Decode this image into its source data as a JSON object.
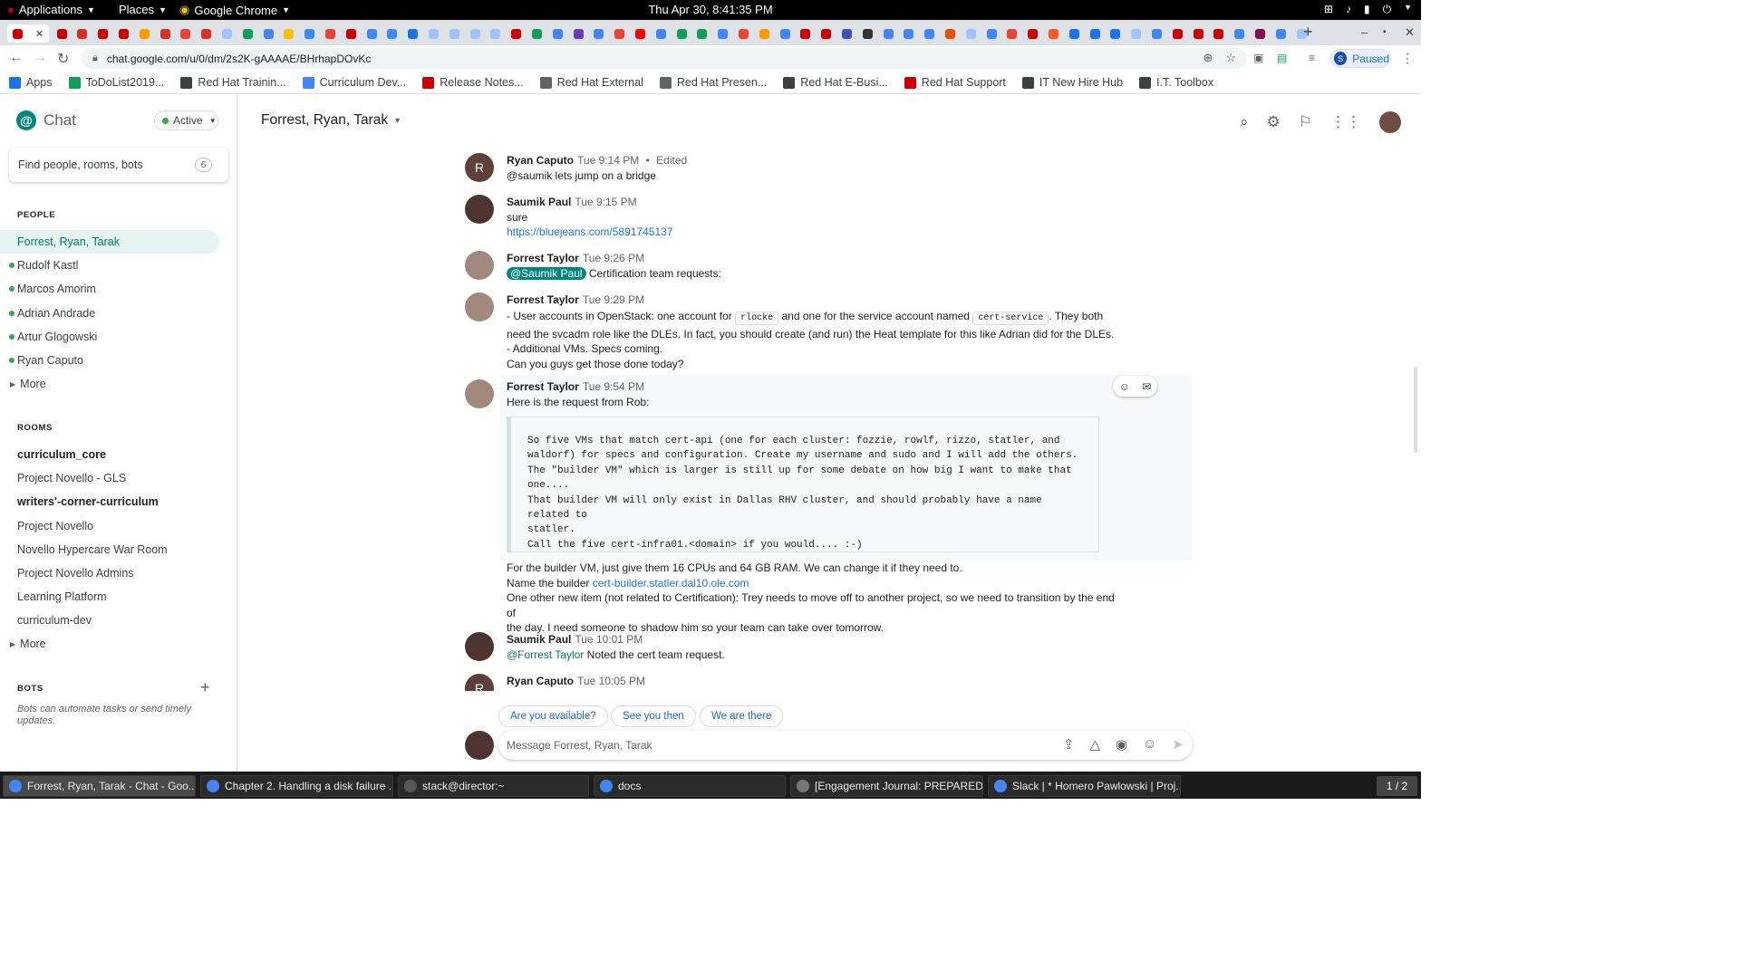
{
  "topbar": {
    "applications": "Applications",
    "places": "Places",
    "browser": "Google Chrome",
    "clock": "Thu Apr 30,  8:41:35 PM"
  },
  "browser": {
    "url": "chat.google.com/u/0/dm/2s2K-gAAAAE/BHrhapDOvKc",
    "profile_initial": "S",
    "profile_status": "Paused",
    "bookmarks": [
      {
        "label": "Apps",
        "color": "#1a73e8"
      },
      {
        "label": "ToDoList2019...",
        "color": "#0f9d58"
      },
      {
        "label": "Red Hat Trainin...",
        "color": "#3c4043"
      },
      {
        "label": "Curriculum Dev...",
        "color": "#4285f4"
      },
      {
        "label": "Release Notes...",
        "color": "#cc0000"
      },
      {
        "label": "Red Hat External",
        "color": "#5f6368"
      },
      {
        "label": "Red Hat Presen...",
        "color": "#5f6368"
      },
      {
        "label": "Red Hat E-Busi...",
        "color": "#3c4043"
      },
      {
        "label": "Red Hat Support",
        "color": "#cc0000"
      },
      {
        "label": "IT New Hire Hub",
        "color": "#3c4043"
      },
      {
        "label": "I.T. Toolbox",
        "color": "#3c4043"
      }
    ]
  },
  "chat": {
    "app_name": "Chat",
    "status": "Active",
    "search_placeholder": "Find people, rooms, bots",
    "search_shortcut": "6",
    "people_label": "PEOPLE",
    "people": [
      {
        "name": "Forrest, Ryan, Tarak",
        "selected": true,
        "online": false
      },
      {
        "name": "Rudolf Kastl",
        "online": true
      },
      {
        "name": "Marcos Amorim",
        "online": true
      },
      {
        "name": "Adrian Andrade",
        "online": true
      },
      {
        "name": "Artur Glogowski",
        "online": true
      },
      {
        "name": "Ryan Caputo",
        "online": true
      }
    ],
    "more_label": "More",
    "rooms_label": "ROOMS",
    "rooms": [
      {
        "name": "curriculum_core",
        "bold": true
      },
      {
        "name": "Project Novello - GLS",
        "bold": false
      },
      {
        "name": "writers'-corner-curriculum",
        "bold": true
      },
      {
        "name": "Project Novello",
        "bold": false
      },
      {
        "name": "Novello Hypercare War Room",
        "bold": false
      },
      {
        "name": "Project Novello Admins",
        "bold": false
      },
      {
        "name": "Learning Platform",
        "bold": false
      },
      {
        "name": "curriculum-dev",
        "bold": false
      }
    ],
    "bots_label": "BOTS",
    "bots_desc": "Bots can automate tasks or send timely updates.",
    "conversation_title": "Forrest, Ryan, Tarak",
    "messages": [
      {
        "author": "Ryan Caputo",
        "time": "Tue 9:14 PM",
        "edited": "Edited",
        "text": "@saumik lets jump on a bridge",
        "initial": "R"
      },
      {
        "author": "Saumik Paul",
        "time": "Tue 9:15 PM",
        "text": "sure",
        "link": "https://bluejeans.com/5891745137"
      },
      {
        "author": "Forrest Taylor",
        "time": "Tue 9:26 PM",
        "mention": "@Saumik Paul",
        "text": "Certification team requests:"
      },
      {
        "author": "Forrest Taylor",
        "time": "Tue 9:29 PM",
        "line1a": "- User accounts in OpenStack: one account for",
        "code1": "rlocke",
        "line1b": "and one for the service account named",
        "code2": "cert-service",
        "line1c": ".  They both",
        "line2": "need the svcadm role like the DLEs. In fact, you should create (and run) the Heat template for this like Adrian did for the DLEs.",
        "line3": "- Additional VMs.  Specs coming.",
        "line4": "Can you guys get those done today?"
      },
      {
        "author": "Forrest Taylor",
        "time": "Tue 9:54 PM",
        "intro": "Here is the request from Rob:",
        "codeblock": "So five VMs that match cert-api (one for each cluster: fozzie, rowlf, rizzo, statler, and\nwaldorf) for specs and configuration. Create my username and sudo and I will add the others.\nThe \"builder VM\" which is larger is still up for some debate on how big I want to make that\none....\nThat builder VM will only exist in Dallas RHV cluster, and should probably have a name related to\nstatler.\nCall the five cert-infra01.<domain> if you would.... :-)",
        "after1": "For the builder VM, just give them 16 CPUs and 64 GB RAM.  We can change it if they need to.",
        "after2_prefix": "Name the builder",
        "after2_link": "cert-builder.statler.dal10.ole.com",
        "after3": "One other new item (not related to Certification): Trey needs to move off to another project, so we need to transition by the end of",
        "after4": "the day.  I need someone to shadow him so your team can take over tomorrow."
      },
      {
        "author": "Saumik Paul",
        "time": "Tue 10:01 PM",
        "mention": "@Forrest Taylor",
        "text": "Noted the cert team request."
      },
      {
        "author": "Ryan Caputo",
        "time": "Tue 10:05 PM",
        "initial": "R"
      }
    ],
    "suggestions": [
      "Are you available?",
      "See you then",
      "We are there"
    ],
    "composer_placeholder": "Message Forrest, Ryan, Tarak"
  },
  "taskbar": {
    "tasks": [
      {
        "label": "Forrest, Ryan, Tarak - Chat - Goo...",
        "active": true,
        "color": "#4285f4"
      },
      {
        "label": "Chapter 2. Handling a disk failure ...",
        "active": false,
        "color": "#4285f4"
      },
      {
        "label": "stack@director:~",
        "active": false,
        "color": "#555555"
      },
      {
        "label": "docs",
        "active": false,
        "color": "#4285f4"
      },
      {
        "label": "[Engagement Journal: PREPARED ...",
        "active": false,
        "color": "#777777"
      },
      {
        "label": "Slack | * Homero Pawlowski | Proj...",
        "active": false,
        "color": "#4285f4"
      }
    ],
    "pager": "1 / 2"
  }
}
